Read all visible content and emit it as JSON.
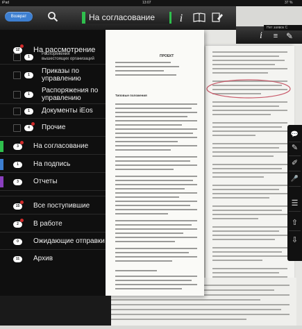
{
  "status_bar": {
    "carrier": "iPad",
    "time": "13:07",
    "battery": "37 %"
  },
  "right_window": {
    "status": "Нет заявок С"
  },
  "header": {
    "back_label": "Возврат",
    "search_icon": "search-icon",
    "tab_label": "На согласование",
    "icons": [
      "info-icon",
      "book-icon",
      "document-edit-icon"
    ]
  },
  "document": {
    "title": "ПРОЕКТ",
    "heading": "Типовые положения"
  },
  "sidebar": {
    "sections": [
      {
        "badge": "12",
        "label": "На рассмотрение",
        "color": ""
      },
      {
        "badge": "1",
        "label": "Распоряжения вышестоящих организаций",
        "color": ""
      },
      {
        "badge": "1",
        "label": "Приказы по управлению",
        "color": ""
      },
      {
        "badge": "1",
        "label": "Распоряжения по управлению",
        "color": ""
      },
      {
        "badge": "1",
        "label": "Документы iEos",
        "color": ""
      },
      {
        "badge": "4",
        "label": "Прочие",
        "color": ""
      },
      {
        "badge": "3",
        "label": "На согласование",
        "color": "#2fbf4d"
      },
      {
        "badge": "1",
        "label": "На подпись",
        "color": "#3d7fd1"
      },
      {
        "badge": "3",
        "label": "Отчеты",
        "color": "#8a3fbf"
      },
      {
        "badge": "15",
        "label": "Все поступившие",
        "color": ""
      },
      {
        "badge": "2",
        "label": "В работе",
        "color": ""
      },
      {
        "badge": "0",
        "label": "Ожидающие отправки",
        "color": ""
      },
      {
        "badge": "11",
        "label": "Архив",
        "color": ""
      }
    ]
  },
  "toolbar": {
    "icons": [
      "comment-icon",
      "pen-icon",
      "marker-icon",
      "microphone-icon",
      "list-icon",
      "upload-icon",
      "download-icon"
    ]
  },
  "colors": {
    "accent_blue": "#3d7fd1",
    "accent_green": "#2fbf4d",
    "badge_dot_red": "#d12a2a"
  }
}
